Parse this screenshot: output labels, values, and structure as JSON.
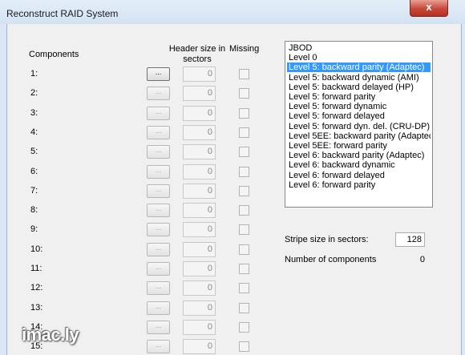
{
  "window": {
    "title": "Reconstruct RAID System",
    "close_glyph": "x"
  },
  "components": {
    "header": "Components",
    "header_size_label": "Header size in sectors",
    "missing_label": "Missing",
    "browse_label": "...",
    "rows": [
      {
        "label": "1:",
        "header_size": "0",
        "missing": false
      },
      {
        "label": "2:",
        "header_size": "0",
        "missing": false
      },
      {
        "label": "3:",
        "header_size": "0",
        "missing": false
      },
      {
        "label": "4:",
        "header_size": "0",
        "missing": false
      },
      {
        "label": "5:",
        "header_size": "0",
        "missing": false
      },
      {
        "label": "6:",
        "header_size": "0",
        "missing": false
      },
      {
        "label": "7:",
        "header_size": "0",
        "missing": false
      },
      {
        "label": "8:",
        "header_size": "0",
        "missing": false
      },
      {
        "label": "9:",
        "header_size": "0",
        "missing": false
      },
      {
        "label": "10:",
        "header_size": "0",
        "missing": false
      },
      {
        "label": "11:",
        "header_size": "0",
        "missing": false
      },
      {
        "label": "12:",
        "header_size": "0",
        "missing": false
      },
      {
        "label": "13:",
        "header_size": "0",
        "missing": false
      },
      {
        "label": "14:",
        "header_size": "0",
        "missing": false
      },
      {
        "label": "15:",
        "header_size": "0",
        "missing": false
      }
    ]
  },
  "raid_levels": {
    "selected": "Level 5: backward parity (Adaptec)",
    "items": [
      "JBOD",
      "Level 0",
      "Level 5: backward parity (Adaptec)",
      "Level 5: backward dynamic (AMI)",
      "Level 5: backward delayed (HP)",
      "Level 5: forward parity",
      "Level 5: forward dynamic",
      "Level 5: forward delayed",
      "Level 5: forward dyn. del. (CRU-DP)",
      "Level 5EE: backward parity (Adaptec)",
      "Level 5EE: forward parity",
      "Level 6: backward parity (Adaptec)",
      "Level 6: backward dynamic",
      "Level 6: forward delayed",
      "Level 6: forward parity"
    ]
  },
  "stripe": {
    "label": "Stripe size in sectors:",
    "value": "128"
  },
  "num_components": {
    "label": "Number of components",
    "value": "0"
  },
  "watermark": "imac.ly",
  "colors": {
    "selection": "#3399ff",
    "close_button": "#c7483a",
    "frame": "#dbe7f4"
  }
}
